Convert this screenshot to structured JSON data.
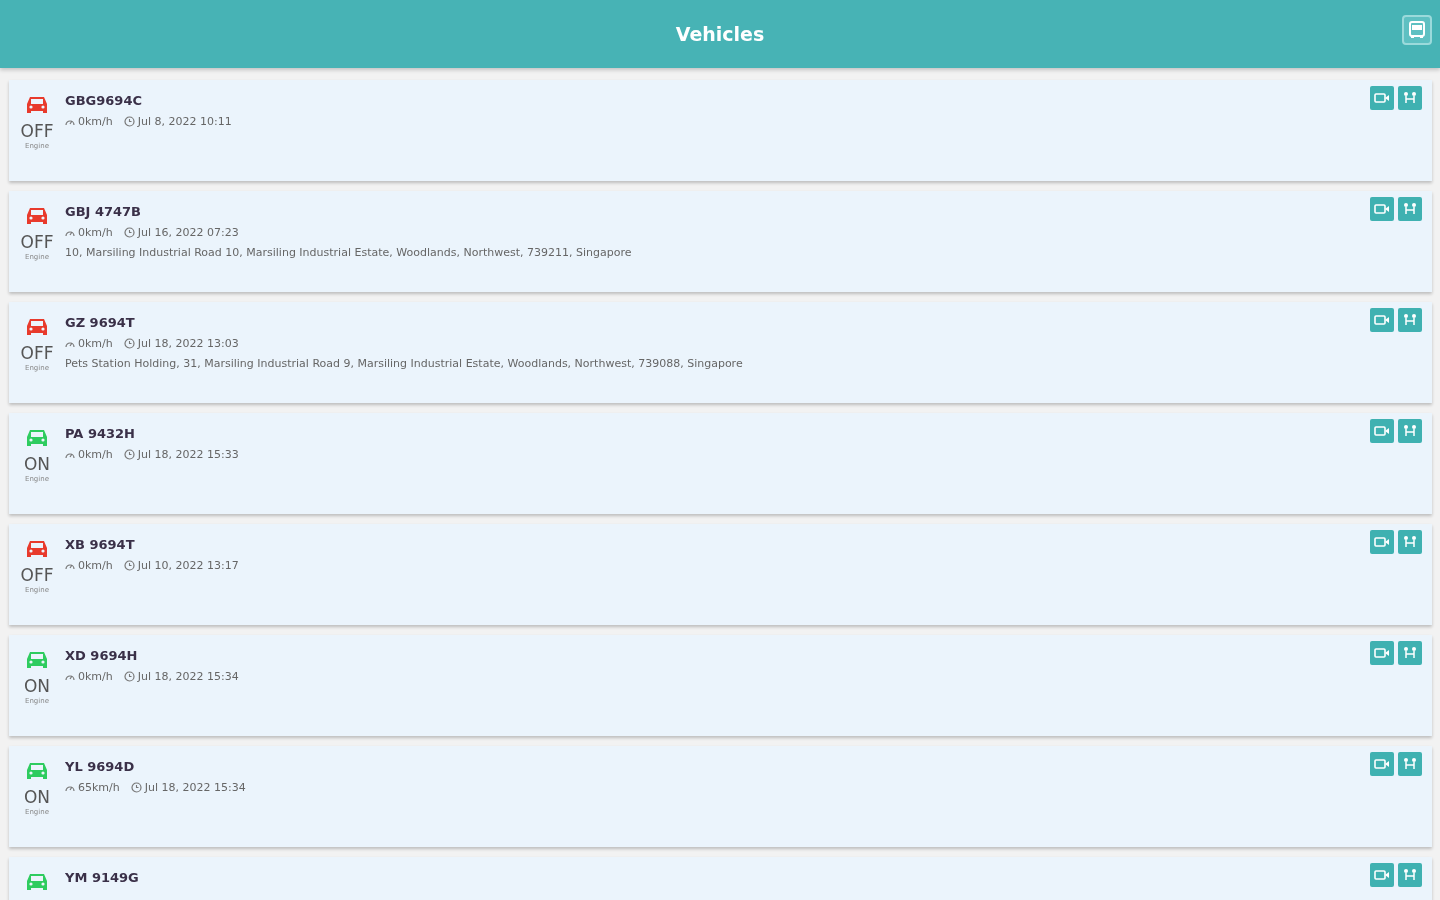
{
  "header": {
    "title": "Vehicles"
  },
  "vehicles": [
    {
      "plate": "GBG9694C",
      "engine_on": false,
      "status": "OFF",
      "status_caption": "Engine",
      "speed": "0km/h",
      "time": "Jul 8, 2022 10:11"
    },
    {
      "plate": "GBJ 4747B",
      "engine_on": false,
      "status": "OFF",
      "status_caption": "Engine",
      "speed": "0km/h",
      "time": "Jul 16, 2022 07:23",
      "address": "10, Marsiling Industrial Road 10, Marsiling Industrial Estate, Woodlands, Northwest, 739211, Singapore"
    },
    {
      "plate": "GZ 9694T",
      "engine_on": false,
      "status": "OFF",
      "status_caption": "Engine",
      "speed": "0km/h",
      "time": "Jul 18, 2022 13:03",
      "address": "Pets Station Holding, 31, Marsiling Industrial Road 9, Marsiling Industrial Estate, Woodlands, Northwest, 739088, Singapore"
    },
    {
      "plate": "PA 9432H",
      "engine_on": true,
      "status": "ON",
      "status_caption": "Engine",
      "speed": "0km/h",
      "time": "Jul 18, 2022 15:33"
    },
    {
      "plate": "XB 9694T",
      "engine_on": false,
      "status": "OFF",
      "status_caption": "Engine",
      "speed": "0km/h",
      "time": "Jul 10, 2022 13:17"
    },
    {
      "plate": "XD 9694H",
      "engine_on": true,
      "status": "ON",
      "status_caption": "Engine",
      "speed": "0km/h",
      "time": "Jul 18, 2022 15:34"
    },
    {
      "plate": "YL 9694D",
      "engine_on": true,
      "status": "ON",
      "status_caption": "Engine",
      "speed": "65km/h",
      "time": "Jul 18, 2022 15:34"
    },
    {
      "plate": "YM 9149G",
      "engine_on": true
    }
  ]
}
